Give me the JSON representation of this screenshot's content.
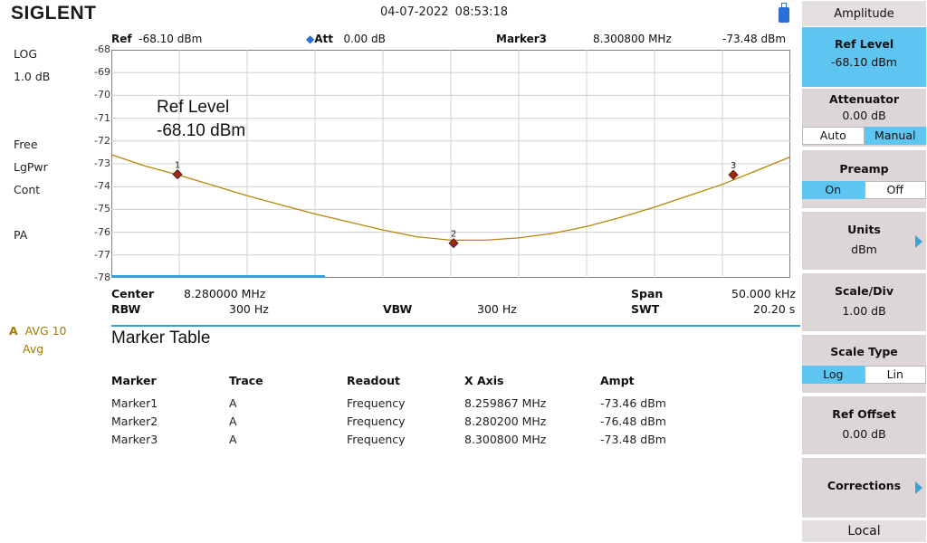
{
  "brand": "SIGLENT",
  "datetime": "04-07-2022   08:53:18",
  "left_info": {
    "scale_type": "LOG",
    "scale_div": "1.0 dB",
    "trigger": "Free",
    "detector": "LgPwr",
    "sweep": "Cont",
    "preamp": "PA"
  },
  "trace_info": {
    "trace": "A",
    "avg": "AVG 10",
    "mode": "Avg"
  },
  "header": {
    "ref_label": "Ref",
    "ref_value": "-68.10 dBm",
    "att_label": "Att",
    "att_value": "0.00 dB",
    "marker_label": "Marker3",
    "marker_freq": "8.300800 MHz",
    "marker_ampt": "-73.48 dBm"
  },
  "ref_overlay": {
    "title": "Ref Level",
    "value": "-68.10 dBm"
  },
  "y_ticks": [
    "-68",
    "-69",
    "-70",
    "-71",
    "-72",
    "-73",
    "-74",
    "-75",
    "-76",
    "-77",
    "-78"
  ],
  "chart_data": {
    "type": "line",
    "x_range_mhz": [
      8.255,
      8.305
    ],
    "ylim": [
      -78,
      -68
    ],
    "series": [
      {
        "x": [
          8.255,
          8.2575,
          8.26,
          8.2625,
          8.265,
          8.2675,
          8.27,
          8.2725,
          8.275,
          8.2775,
          8.28,
          8.2825,
          8.285,
          8.2875,
          8.29,
          8.2925,
          8.295,
          8.2975,
          8.3,
          8.3025,
          8.305
        ],
        "y": [
          -72.6,
          -73.1,
          -73.5,
          -73.95,
          -74.4,
          -74.8,
          -75.2,
          -75.55,
          -75.9,
          -76.2,
          -76.35,
          -76.35,
          -76.25,
          -76.05,
          -75.75,
          -75.35,
          -74.9,
          -74.4,
          -73.9,
          -73.3,
          -72.7
        ]
      }
    ],
    "markers": [
      {
        "label": "1",
        "x": 8.259867,
        "y": -73.46
      },
      {
        "label": "2",
        "x": 8.2802,
        "y": -76.48
      },
      {
        "label": "3",
        "x": 8.3008,
        "y": -73.48
      }
    ]
  },
  "below": {
    "center_label": "Center",
    "center_value": "8.280000 MHz",
    "span_label": "Span",
    "span_value": "50.000 kHz",
    "rbw_label": "RBW",
    "rbw_value": "300 Hz",
    "vbw_label": "VBW",
    "vbw_value": "300 Hz",
    "swt_label": "SWT",
    "swt_value": "20.20 s"
  },
  "marker_table": {
    "title": "Marker Table",
    "headers": [
      "Marker",
      "Trace",
      "Readout",
      "X Axis",
      "Ampt"
    ],
    "rows": [
      [
        "Marker1",
        "A",
        "Frequency",
        "8.259867 MHz",
        "-73.46 dBm"
      ],
      [
        "Marker2",
        "A",
        "Frequency",
        "8.280200 MHz",
        "-76.48 dBm"
      ],
      [
        "Marker3",
        "A",
        "Frequency",
        "8.300800 MHz",
        "-73.48 dBm"
      ]
    ]
  },
  "panel": {
    "title": "Amplitude",
    "ref_level": {
      "label": "Ref Level",
      "value": "-68.10 dBm"
    },
    "attenuator": {
      "label": "Attenuator",
      "value": "0.00 dB",
      "opt_a": "Auto",
      "opt_b": "Manual"
    },
    "preamp": {
      "label": "Preamp",
      "opt_a": "On",
      "opt_b": "Off"
    },
    "units": {
      "label": "Units",
      "value": "dBm"
    },
    "scale_div": {
      "label": "Scale/Div",
      "value": "1.00 dB"
    },
    "scale_type": {
      "label": "Scale Type",
      "opt_a": "Log",
      "opt_b": "Lin"
    },
    "ref_offset": {
      "label": "Ref Offset",
      "value": "0.00 dB"
    },
    "corrections": {
      "label": "Corrections"
    },
    "local": "Local"
  },
  "colors": {
    "trace": "#b8860b",
    "marker": "#a02810",
    "accent": "#5ec4f0",
    "brand_blue": "#2a6fd6"
  }
}
